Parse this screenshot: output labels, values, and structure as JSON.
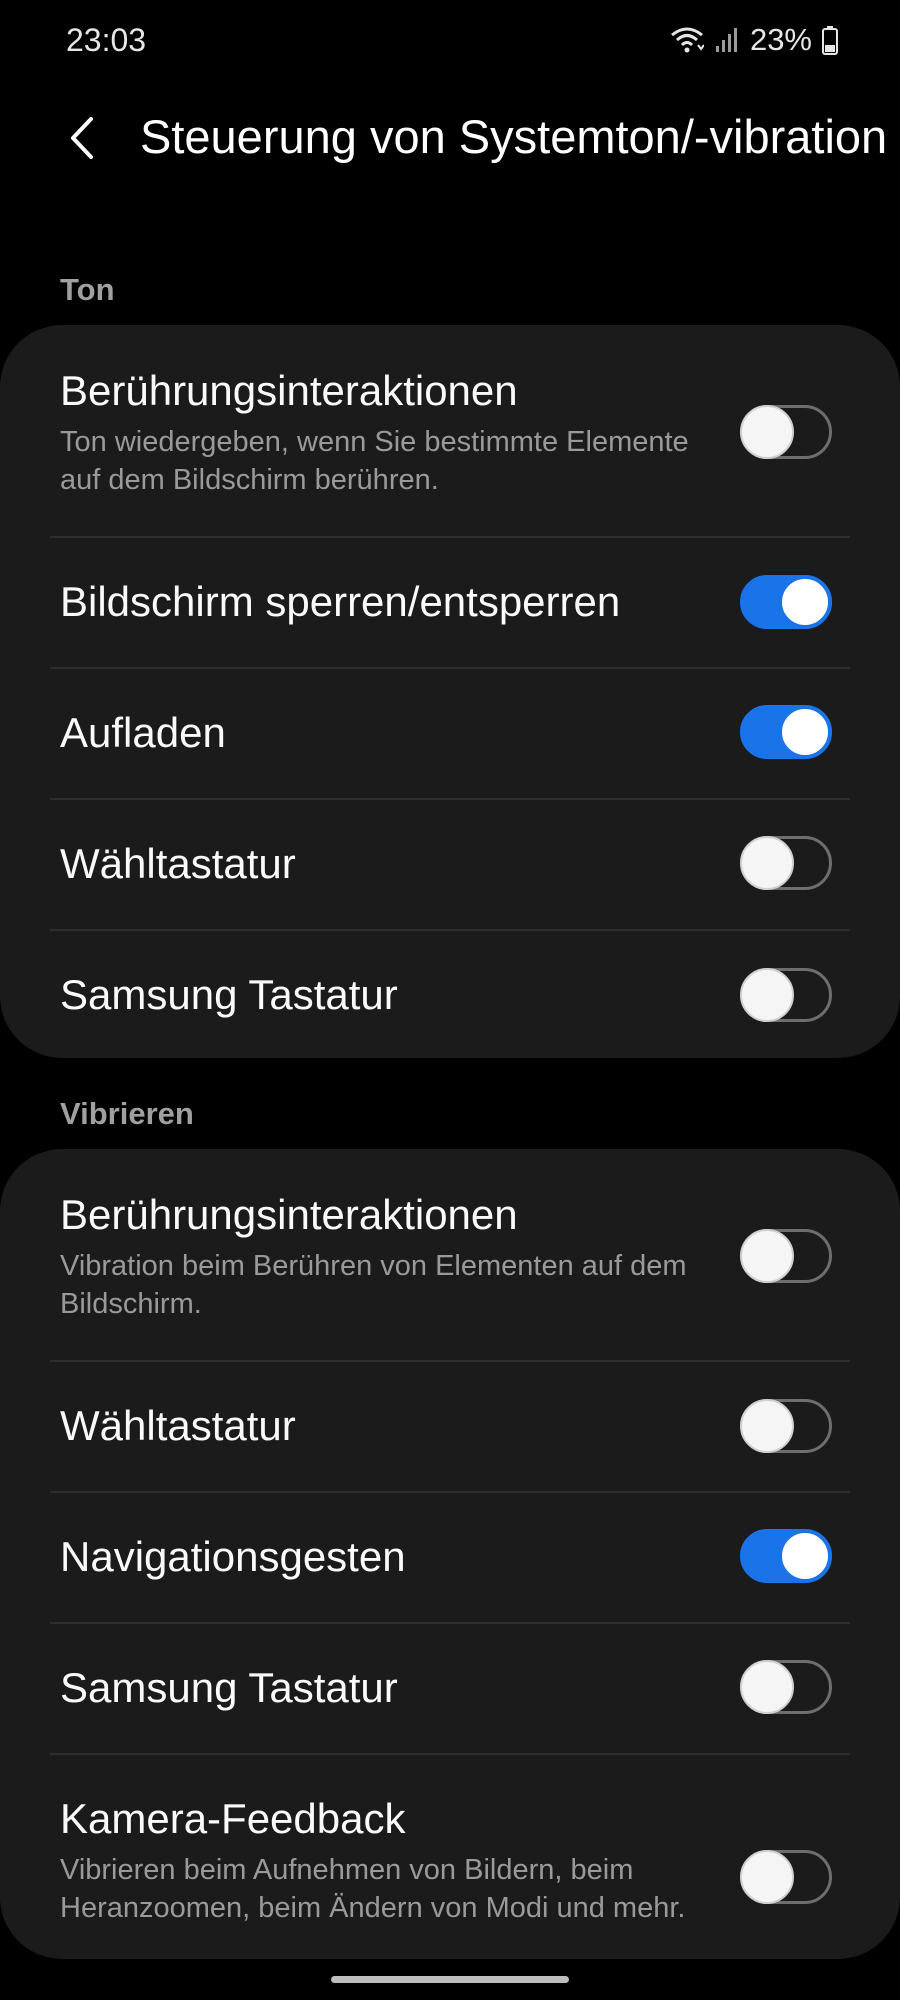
{
  "status_bar": {
    "time": "23:03",
    "battery_percent": "23%",
    "icons": [
      "wifi-icon",
      "signal-icon",
      "battery-icon"
    ]
  },
  "header": {
    "title": "Steuerung von Systemton/-vibration",
    "back_icon": "back-arrow-icon"
  },
  "sections": {
    "sound": {
      "label": "Ton",
      "items": [
        {
          "title": "Berührungsinteraktionen",
          "subtitle": "Ton wiedergeben, wenn Sie bestimmte Elemente auf dem Bildschirm berühren.",
          "enabled": false
        },
        {
          "title": "Bildschirm sperren/entsperren",
          "enabled": true
        },
        {
          "title": "Aufladen",
          "enabled": true
        },
        {
          "title": "Wähltastatur",
          "enabled": false
        },
        {
          "title": "Samsung Tastatur",
          "enabled": false
        }
      ]
    },
    "vibration": {
      "label": "Vibrieren",
      "items": [
        {
          "title": "Berührungsinteraktionen",
          "subtitle": "Vibration beim Berühren von Elementen auf dem Bildschirm.",
          "enabled": false
        },
        {
          "title": "Wähltastatur",
          "enabled": false
        },
        {
          "title": "Navigationsgesten",
          "enabled": true
        },
        {
          "title": "Samsung Tastatur",
          "enabled": false
        },
        {
          "title": "Kamera-Feedback",
          "subtitle": "Vibrieren beim Aufnehmen von Bildern, beim Heranzoomen, beim Ändern von Modi und mehr.",
          "enabled": false
        }
      ]
    }
  },
  "colors": {
    "background": "#000000",
    "card": "#1b1b1b",
    "toggle_on": "#1a73e8",
    "section_label": "#a0a0a0"
  }
}
